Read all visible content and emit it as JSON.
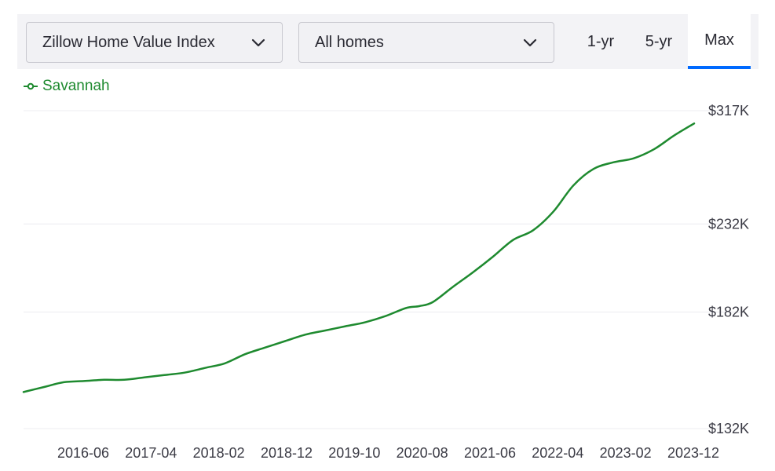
{
  "toolbar": {
    "metric_select": "Zillow Home Value Index",
    "home_type_select": "All homes",
    "range_tabs": [
      "1-yr",
      "5-yr",
      "Max"
    ],
    "active_range": "Max"
  },
  "colors": {
    "series": "#1e8a2f",
    "accent": "#006aff",
    "grid": "#ececf0"
  },
  "chart_data": {
    "type": "line",
    "series": [
      {
        "name": "Savannah",
        "points": [
          [
            "2015-09",
            146
          ],
          [
            "2015-12",
            148
          ],
          [
            "2016-03",
            150
          ],
          [
            "2016-06",
            150.5
          ],
          [
            "2016-09",
            151
          ],
          [
            "2016-12",
            151
          ],
          [
            "2017-03",
            152
          ],
          [
            "2017-06",
            153
          ],
          [
            "2017-09",
            154
          ],
          [
            "2017-12",
            156
          ],
          [
            "2018-03",
            158
          ],
          [
            "2018-06",
            162
          ],
          [
            "2018-09",
            165
          ],
          [
            "2018-12",
            168
          ],
          [
            "2019-03",
            171
          ],
          [
            "2019-06",
            173
          ],
          [
            "2019-09",
            175
          ],
          [
            "2019-12",
            177
          ],
          [
            "2020-03",
            180
          ],
          [
            "2020-06",
            184
          ],
          [
            "2020-08",
            185
          ],
          [
            "2020-10",
            187
          ],
          [
            "2021-01",
            195
          ],
          [
            "2021-04",
            203
          ],
          [
            "2021-07",
            212
          ],
          [
            "2021-10",
            222
          ],
          [
            "2022-01",
            228
          ],
          [
            "2022-04",
            240
          ],
          [
            "2022-07",
            258
          ],
          [
            "2022-10",
            270
          ],
          [
            "2023-01",
            275
          ],
          [
            "2023-04",
            278
          ],
          [
            "2023-07",
            285
          ],
          [
            "2023-10",
            296
          ],
          [
            "2024-01",
            306
          ]
        ]
      }
    ],
    "x_tick_labels": [
      "2016-06",
      "2017-04",
      "2018-02",
      "2018-12",
      "2019-10",
      "2020-08",
      "2021-06",
      "2022-04",
      "2023-02",
      "2023-12"
    ],
    "y_tick_labels": [
      "$317K",
      "$232K",
      "$182K",
      "$132K"
    ],
    "y_ticks": [
      317,
      232,
      182,
      132
    ],
    "xlim": [
      "2015-09",
      "2024-01"
    ],
    "ylim": [
      132,
      317
    ],
    "y_scale": "log",
    "grid": true,
    "legend_position": "top-left"
  }
}
